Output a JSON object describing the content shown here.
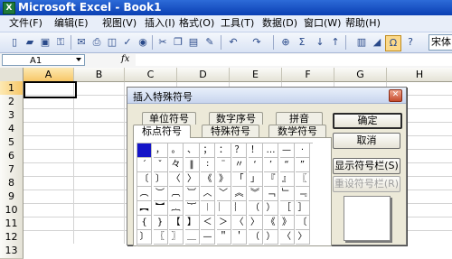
{
  "window": {
    "title": "Microsoft Excel - Book1",
    "app_icon": "excel-icon"
  },
  "menu": [
    {
      "label": "文件(F)"
    },
    {
      "label": "编辑(E)"
    },
    {
      "label": "视图(V)"
    },
    {
      "label": "插入(I)"
    },
    {
      "label": "格式(O)"
    },
    {
      "label": "工具(T)"
    },
    {
      "label": "数据(D)"
    },
    {
      "label": "窗口(W)"
    },
    {
      "label": "帮助(H)"
    }
  ],
  "toolbar": {
    "icons": [
      "new-icon",
      "open-icon",
      "save-icon",
      "permission-icon",
      "email-icon",
      "print-icon",
      "print-preview-icon",
      "spelling-icon",
      "research-icon",
      "cut-icon",
      "copy-icon",
      "paste-icon",
      "format-painter-icon",
      "undo-icon",
      "redo-icon",
      "hyperlink-icon",
      "autosum-icon",
      "sort-ascending-icon",
      "sort-descending-icon",
      "chart-wizard-icon",
      "drawing-icon",
      "insert-symbol-icon",
      "help-icon"
    ],
    "font_name": "宋体"
  },
  "formula_bar": {
    "name_box": "A1",
    "fx_label": "fx",
    "formula": ""
  },
  "sheet": {
    "columns": [
      "A",
      "B",
      "C",
      "D",
      "E",
      "F",
      "G",
      "H"
    ],
    "rows": [
      "1",
      "2",
      "3",
      "4",
      "5",
      "6",
      "7",
      "8",
      "9",
      "10",
      "11",
      "12",
      "13"
    ],
    "active_cell": "A1"
  },
  "dialog": {
    "title": "插入特殊符号",
    "tabs_back": [
      "单位符号",
      "数字序号",
      "拼音"
    ],
    "tabs_front": [
      "标点符号",
      "特殊符号",
      "数学符号"
    ],
    "active_tab": "标点符号",
    "symbols": [
      [
        "",
        "，",
        "。",
        "、",
        "；",
        "：",
        "？",
        "！",
        "…",
        "—",
        "·"
      ],
      [
        "ˊ",
        "ˇ",
        "々",
        "‖",
        "∶",
        "¨",
        "〃",
        "‘",
        "’",
        "“",
        "”"
      ],
      [
        "〔",
        "〕",
        "〈",
        "〉",
        "《",
        "》",
        "「",
        "」",
        "『",
        "』",
        "〖"
      ],
      [
        "︵",
        "︶",
        "︹",
        "︺",
        "︿",
        "﹀",
        "︽",
        "︾",
        "﹁",
        "﹂",
        "﹃"
      ],
      [
        "︻",
        "︼",
        "︷",
        "︸",
        "︱",
        "︳",
        "︴",
        "（",
        "）",
        "［",
        "］"
      ],
      [
        "{",
        "}",
        "【",
        "】",
        "＜",
        "＞",
        "〈",
        "〉",
        "《",
        "》",
        "〔"
      ],
      [
        "〕",
        "〖",
        "〗",
        "＿",
        "—",
        "＂",
        "＇",
        "（",
        "）",
        "〈",
        "〉"
      ]
    ],
    "buttons": {
      "ok": "确定",
      "cancel": "取消",
      "show_toolbar": "显示符号栏(S)",
      "reset_toolbar": "重设符号栏(R)"
    }
  }
}
